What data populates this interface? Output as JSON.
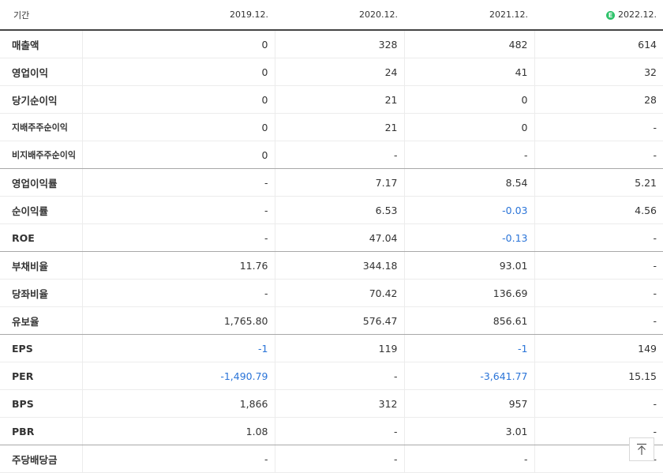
{
  "header": {
    "label": "기간",
    "periods": [
      "2019.12.",
      "2020.12.",
      "2021.12.",
      "2022.12."
    ],
    "estimate_badge": "E"
  },
  "rows": [
    {
      "label": "매출액",
      "values": [
        "0",
        "328",
        "482",
        "614"
      ],
      "small": false,
      "sep": false
    },
    {
      "label": "영업이익",
      "values": [
        "0",
        "24",
        "41",
        "32"
      ],
      "small": false,
      "sep": false
    },
    {
      "label": "당기순이익",
      "values": [
        "0",
        "21",
        "0",
        "28"
      ],
      "small": false,
      "sep": false
    },
    {
      "label": "지배주주순이익",
      "values": [
        "0",
        "21",
        "0",
        "-"
      ],
      "small": true,
      "sep": false
    },
    {
      "label": "비지배주주순이익",
      "values": [
        "0",
        "-",
        "-",
        "-"
      ],
      "small": true,
      "sep": true
    },
    {
      "label": "영업이익률",
      "values": [
        "-",
        "7.17",
        "8.54",
        "5.21"
      ],
      "small": false,
      "sep": false
    },
    {
      "label": "순이익률",
      "values": [
        "-",
        "6.53",
        "-0.03",
        "4.56"
      ],
      "small": false,
      "sep": false
    },
    {
      "label": "ROE",
      "values": [
        "-",
        "47.04",
        "-0.13",
        "-"
      ],
      "small": false,
      "sep": true
    },
    {
      "label": "부채비율",
      "values": [
        "11.76",
        "344.18",
        "93.01",
        "-"
      ],
      "small": false,
      "sep": false
    },
    {
      "label": "당좌비율",
      "values": [
        "-",
        "70.42",
        "136.69",
        "-"
      ],
      "small": false,
      "sep": false
    },
    {
      "label": "유보율",
      "values": [
        "1,765.80",
        "576.47",
        "856.61",
        "-"
      ],
      "small": false,
      "sep": true
    },
    {
      "label": "EPS",
      "values": [
        "-1",
        "119",
        "-1",
        "149"
      ],
      "small": false,
      "sep": false
    },
    {
      "label": "PER",
      "values": [
        "-1,490.79",
        "-",
        "-3,641.77",
        "15.15"
      ],
      "small": false,
      "sep": false
    },
    {
      "label": "BPS",
      "values": [
        "1,866",
        "312",
        "957",
        "-"
      ],
      "small": false,
      "sep": false
    },
    {
      "label": "PBR",
      "values": [
        "1.08",
        "-",
        "3.01",
        "-"
      ],
      "small": false,
      "sep": true
    },
    {
      "label": "주당배당금",
      "values": [
        "-",
        "-",
        "-",
        "-"
      ],
      "small": false,
      "sep": false
    }
  ],
  "colors": {
    "negative": "#2a74d8",
    "estimate_badge": "#2fc36b"
  },
  "icons": {
    "scroll_top": "arrow-to-top-icon"
  }
}
